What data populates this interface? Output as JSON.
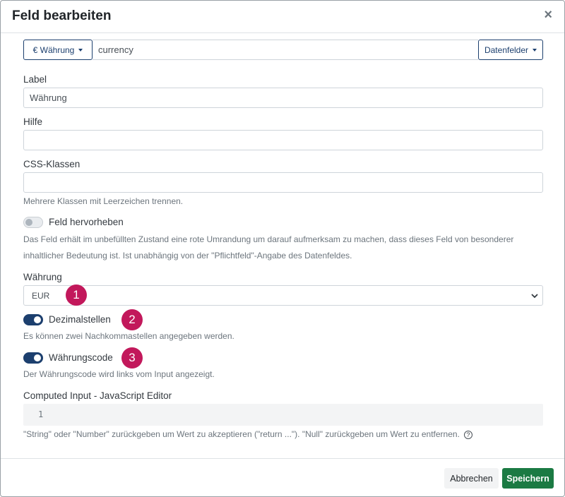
{
  "dialog": {
    "title": "Feld bearbeiten",
    "close_symbol": "×"
  },
  "top_row": {
    "type_button_label": "€ Währung",
    "field_name_value": "currency",
    "datafields_button_label": "Datenfelder"
  },
  "label_field": {
    "label": "Label",
    "value": "Währung"
  },
  "help_field": {
    "label": "Hilfe",
    "value": ""
  },
  "css_field": {
    "label": "CSS-Klassen",
    "value": "",
    "help": "Mehrere Klassen mit Leerzeichen trennen."
  },
  "highlight": {
    "label": "Feld hervorheben",
    "enabled": false,
    "help_line1": "Das Feld erhält im unbefüllten Zustand eine rote Umrandung um darauf aufmerksam zu machen, dass dieses Feld von besonderer",
    "help_line2": "inhaltlicher Bedeutung ist. Ist unabhängig von der \"Pflichtfeld\"-Angabe des Datenfeldes."
  },
  "currency_select": {
    "label": "Währung",
    "value": "EUR",
    "badge": "1"
  },
  "decimals": {
    "label": "Dezimalstellen",
    "enabled": true,
    "help": "Es können zwei Nachkommastellen angegeben werden.",
    "badge": "2"
  },
  "currency_code": {
    "label": "Währungscode",
    "enabled": true,
    "help": "Der Währungscode wird links vom Input angezeigt.",
    "badge": "3"
  },
  "computed_input": {
    "label": "Computed Input - JavaScript Editor",
    "line_number": "1",
    "help": "\"String\" oder \"Number\" zurückgeben um Wert zu akzeptieren (\"return ...\"). \"Null\" zurückgeben um Wert zu entfernen.",
    "help_icon": "?"
  },
  "footer": {
    "cancel_label": "Abbrechen",
    "save_label": "Speichern"
  },
  "colors": {
    "primary": "#1c3f6e",
    "save": "#1b7a43",
    "badge": "#c2185b"
  }
}
